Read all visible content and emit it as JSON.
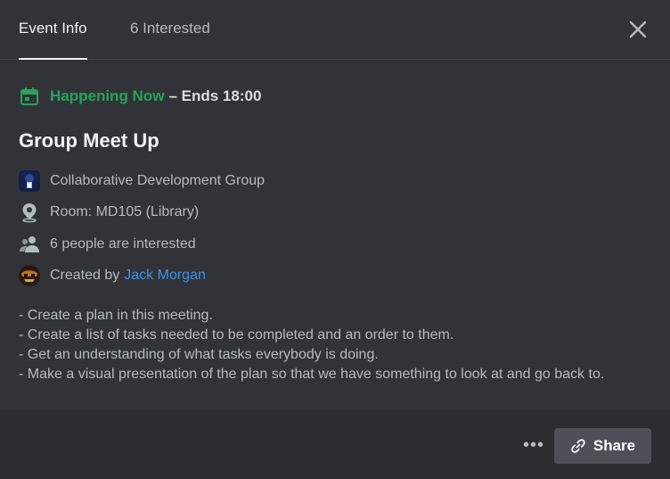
{
  "header": {
    "tabs": [
      {
        "label": "Event Info",
        "active": true
      },
      {
        "label": "6 Interested",
        "active": false
      }
    ]
  },
  "event": {
    "status": "Happening Now",
    "ends": "– Ends 18:00",
    "title": "Group Meet Up",
    "details": [
      {
        "icon": "server-icon",
        "text": "Collaborative Development Group"
      },
      {
        "icon": "location-pin-icon",
        "text": "Room: MD105 (Library)"
      },
      {
        "icon": "people-icon",
        "text": "6 people are interested"
      },
      {
        "icon": "avatar",
        "prefix": "Created by",
        "link": "Jack Morgan"
      }
    ],
    "description": [
      "- Create a plan in this meeting.",
      "- Create a list of tasks needed to be completed and an order to them.",
      "- Get an understanding of what tasks everybody is doing.",
      "- Make a visual presentation of the plan so that we have something to look at and go back to."
    ]
  },
  "footer": {
    "more_label": "•••",
    "share_label": "Share"
  },
  "colors": {
    "status_green": "#23a559",
    "link_blue": "#3a95e4",
    "background": "#313338",
    "footer_bg": "#2b2d31",
    "button_bg": "#4e5058"
  }
}
